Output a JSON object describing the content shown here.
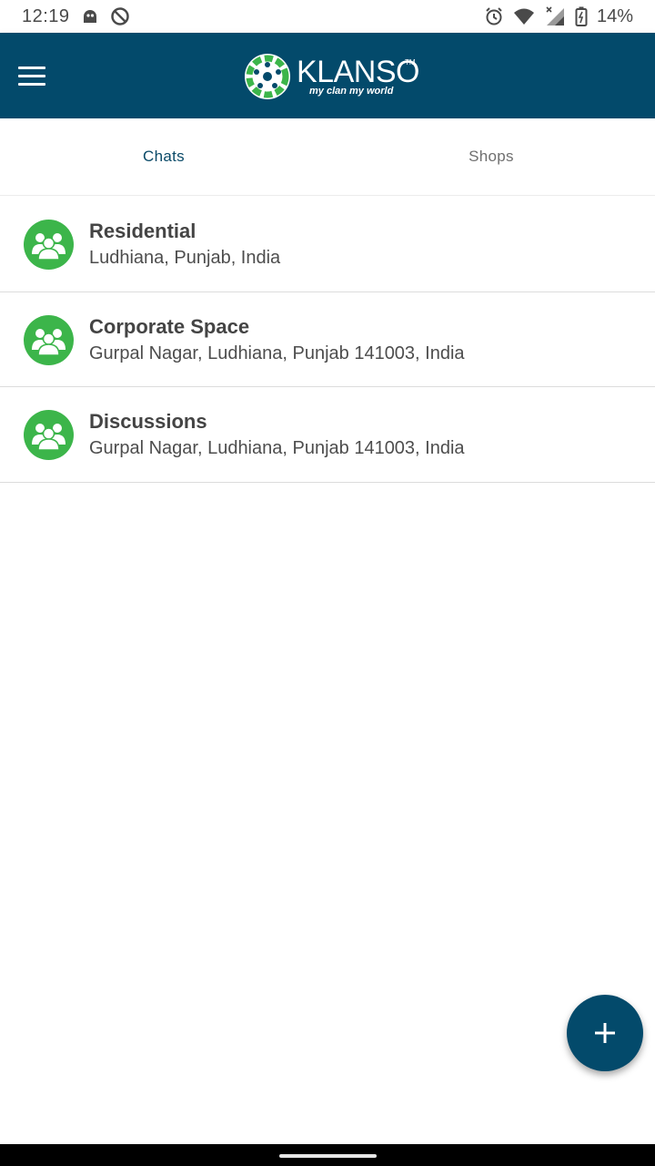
{
  "status_bar": {
    "time": "12:19",
    "battery": "14%",
    "icons": [
      "ghost-icon",
      "blocked-icon",
      "alarm-icon",
      "wifi-icon",
      "signal-icon",
      "battery-icon"
    ]
  },
  "app_bar": {
    "menu_icon": "hamburger-menu-icon",
    "logo_word": "KLANSO",
    "logo_tm": "TM",
    "logo_tagline": "my clan my world",
    "color": "#034a6b"
  },
  "tabs": [
    {
      "label": "Chats",
      "active": true
    },
    {
      "label": "Shops",
      "active": false
    }
  ],
  "chats": [
    {
      "title": "Residential",
      "subtitle": "Ludhiana, Punjab, India",
      "icon": "group-icon"
    },
    {
      "title": "Corporate Space",
      "subtitle": "Gurpal Nagar, Ludhiana, Punjab 141003, India",
      "icon": "group-icon"
    },
    {
      "title": "Discussions",
      "subtitle": "Gurpal Nagar, Ludhiana, Punjab 141003, India",
      "icon": "group-icon"
    }
  ],
  "fab": {
    "icon": "plus-icon"
  },
  "colors": {
    "primary": "#034a6b",
    "avatar_green": "#3cb54a",
    "active_tab": "#0a4a68"
  }
}
